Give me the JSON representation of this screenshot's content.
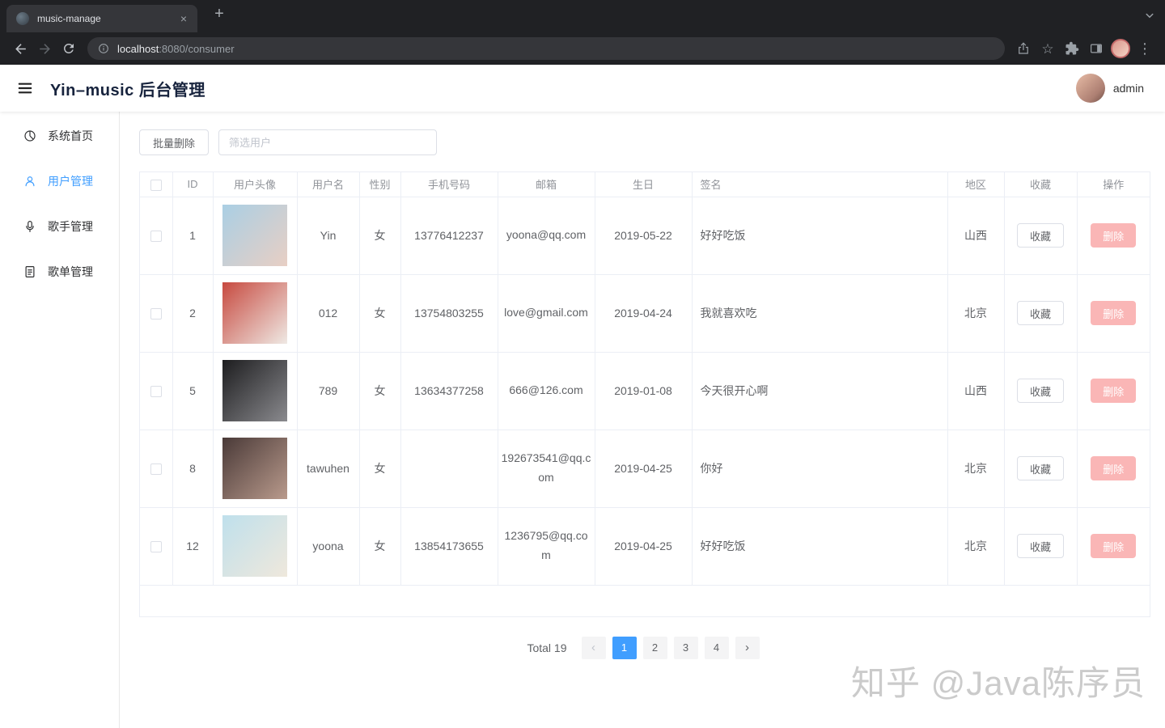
{
  "browser": {
    "tab_title": "music-manage",
    "url_host": "localhost",
    "url_path": ":8080/consumer"
  },
  "header": {
    "title": "Yin–music 后台管理",
    "username": "admin"
  },
  "sidebar": {
    "items": [
      {
        "label": "系统首页"
      },
      {
        "label": "用户管理"
      },
      {
        "label": "歌手管理"
      },
      {
        "label": "歌单管理"
      }
    ]
  },
  "toolbar": {
    "batch_delete_label": "批量删除",
    "filter_placeholder": "筛选用户"
  },
  "table": {
    "columns": [
      "ID",
      "用户头像",
      "用户名",
      "性别",
      "手机号码",
      "邮箱",
      "生日",
      "签名",
      "地区",
      "收藏",
      "操作"
    ],
    "favorite_label": "收藏",
    "delete_label": "删除",
    "rows": [
      {
        "id": "1",
        "username": "Yin",
        "gender": "女",
        "phone": "13776412237",
        "email": "yoona@qq.com",
        "birthday": "2019-05-22",
        "signature": "好好吃饭",
        "region": "山西",
        "avatar": [
          "#aacfe4",
          "#e8cfc4"
        ]
      },
      {
        "id": "2",
        "username": "012",
        "gender": "女",
        "phone": "13754803255",
        "email": "love@gmail.com",
        "birthday": "2019-04-24",
        "signature": "我就喜欢吃",
        "region": "北京",
        "avatar": [
          "#c74a40",
          "#efe9e4"
        ]
      },
      {
        "id": "5",
        "username": "789",
        "gender": "女",
        "phone": "13634377258",
        "email": "666@126.com",
        "birthday": "2019-01-08",
        "signature": "今天很开心啊",
        "region": "山西",
        "avatar": [
          "#1d1d1f",
          "#8a8a8e"
        ]
      },
      {
        "id": "8",
        "username": "tawuhen",
        "gender": "女",
        "phone": "",
        "email": "192673541@qq.com",
        "birthday": "2019-04-25",
        "signature": "你好",
        "region": "北京",
        "avatar": [
          "#4a3a38",
          "#b99a8c"
        ]
      },
      {
        "id": "12",
        "username": "yoona",
        "gender": "女",
        "phone": "13854173655",
        "email": "1236795@qq.com",
        "birthday": "2019-04-25",
        "signature": "好好吃饭",
        "region": "北京",
        "avatar": [
          "#bfe0ec",
          "#efe8dc"
        ]
      }
    ]
  },
  "pagination": {
    "total_label": "Total 19",
    "prev_icon": "‹",
    "next_icon": "›",
    "pages": [
      "1",
      "2",
      "3",
      "4"
    ],
    "active_page": "1"
  },
  "watermark": "知乎 @Java陈序员",
  "colors": {
    "accent": "#409EFF",
    "danger": "#FAB6B6"
  }
}
